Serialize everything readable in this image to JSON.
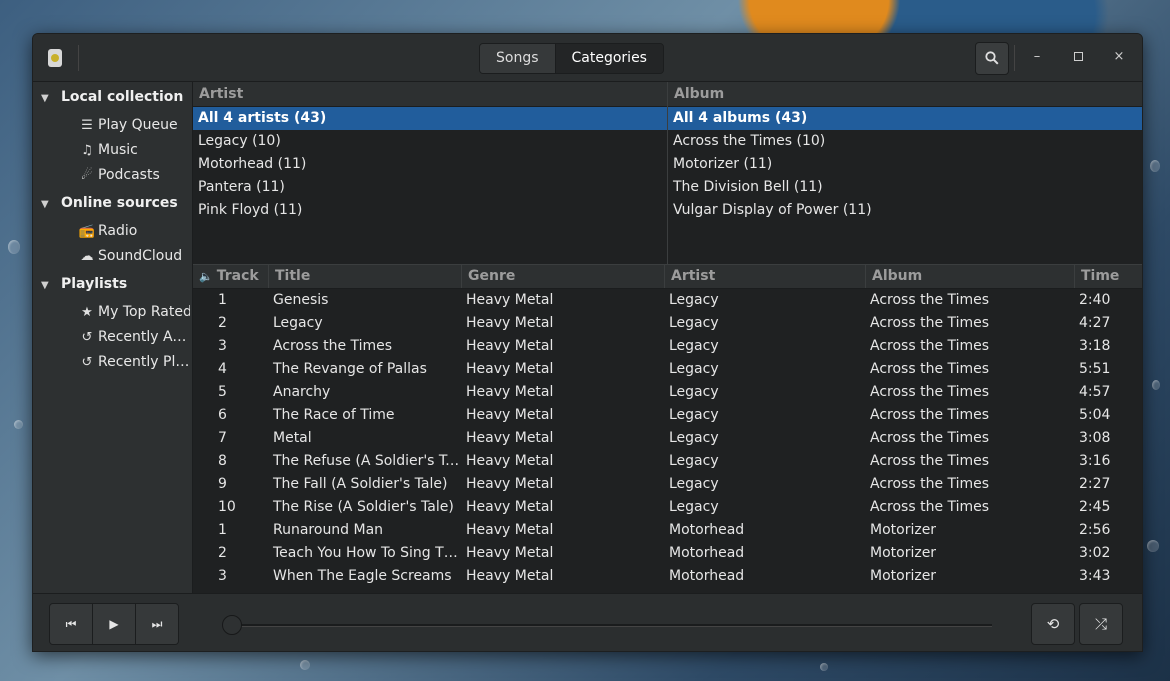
{
  "header": {
    "app_icon": "rhythmbox-icon",
    "view_tabs": [
      "Songs",
      "Categories"
    ],
    "active_tab": "Categories",
    "search_icon": "search-icon",
    "window_controls": [
      "minimize-icon",
      "maximize-icon",
      "close-icon"
    ]
  },
  "sidebar": {
    "sections": [
      {
        "label": "Local collection",
        "items": [
          {
            "label": "Play Queue",
            "icon": "list-icon"
          },
          {
            "label": "Music",
            "icon": "music-note-icon"
          },
          {
            "label": "Podcasts",
            "icon": "rss-icon"
          }
        ]
      },
      {
        "label": "Online sources",
        "items": [
          {
            "label": "Radio",
            "icon": "radio-icon"
          },
          {
            "label": "SoundCloud",
            "icon": "cloud-icon"
          }
        ]
      },
      {
        "label": "Playlists",
        "items": [
          {
            "label": "My Top Rated",
            "icon": "star-icon"
          },
          {
            "label": "Recently Added",
            "icon": "history-icon"
          },
          {
            "label": "Recently Played",
            "icon": "history-icon"
          }
        ]
      }
    ],
    "toolbar": {
      "add": "+",
      "remove": "−",
      "eject": "⏏"
    }
  },
  "browser": {
    "artist": {
      "header": "Artist",
      "rows": [
        "All 4 artists (43)",
        "Legacy (10)",
        "Motorhead (11)",
        "Pantera (11)",
        "Pink Floyd (11)"
      ],
      "selected": 0
    },
    "album": {
      "header": "Album",
      "rows": [
        "All 4 albums (43)",
        "Across the Times (10)",
        "Motorizer (11)",
        "The Division Bell (11)",
        "Vulgar Display of Power (11)"
      ],
      "selected": 0
    }
  },
  "tracks": {
    "columns": [
      "Track",
      "Title",
      "Genre",
      "Artist",
      "Album",
      "Time"
    ],
    "rows": [
      [
        "1",
        "Genesis",
        "Heavy Metal",
        "Legacy",
        "Across the Times",
        "2:40"
      ],
      [
        "2",
        "Legacy",
        "Heavy Metal",
        "Legacy",
        "Across the Times",
        "4:27"
      ],
      [
        "3",
        "Across the Times",
        "Heavy Metal",
        "Legacy",
        "Across the Times",
        "3:18"
      ],
      [
        "4",
        "The Revange of Pallas",
        "Heavy Metal",
        "Legacy",
        "Across the Times",
        "5:51"
      ],
      [
        "5",
        "Anarchy",
        "Heavy Metal",
        "Legacy",
        "Across the Times",
        "4:57"
      ],
      [
        "6",
        "The Race of Time",
        "Heavy Metal",
        "Legacy",
        "Across the Times",
        "5:04"
      ],
      [
        "7",
        "Metal",
        "Heavy Metal",
        "Legacy",
        "Across the Times",
        "3:08"
      ],
      [
        "8",
        "The Refuse (A Soldier's Tale)",
        "Heavy Metal",
        "Legacy",
        "Across the Times",
        "3:16"
      ],
      [
        "9",
        "The Fall (A Soldier's Tale)",
        "Heavy Metal",
        "Legacy",
        "Across the Times",
        "2:27"
      ],
      [
        "10",
        "The Rise (A Soldier's Tale)",
        "Heavy Metal",
        "Legacy",
        "Across the Times",
        "2:45"
      ],
      [
        "1",
        "Runaround Man",
        "Heavy Metal",
        "Motorhead",
        "Motorizer",
        "2:56"
      ],
      [
        "2",
        "Teach You How To Sing The Blues",
        "Heavy Metal",
        "Motorhead",
        "Motorizer",
        "3:02"
      ],
      [
        "3",
        "When The Eagle Screams",
        "Heavy Metal",
        "Motorhead",
        "Motorizer",
        "3:43"
      ]
    ]
  },
  "playbar": {
    "prev_icon": "previous-icon",
    "play_icon": "play-icon",
    "next_icon": "next-icon",
    "repeat_icon": "repeat-icon",
    "shuffle_icon": "shuffle-icon",
    "position": 0
  },
  "colors": {
    "selection": "#215d9c",
    "window_bg": "#353839",
    "list_bg": "#1f2122"
  }
}
